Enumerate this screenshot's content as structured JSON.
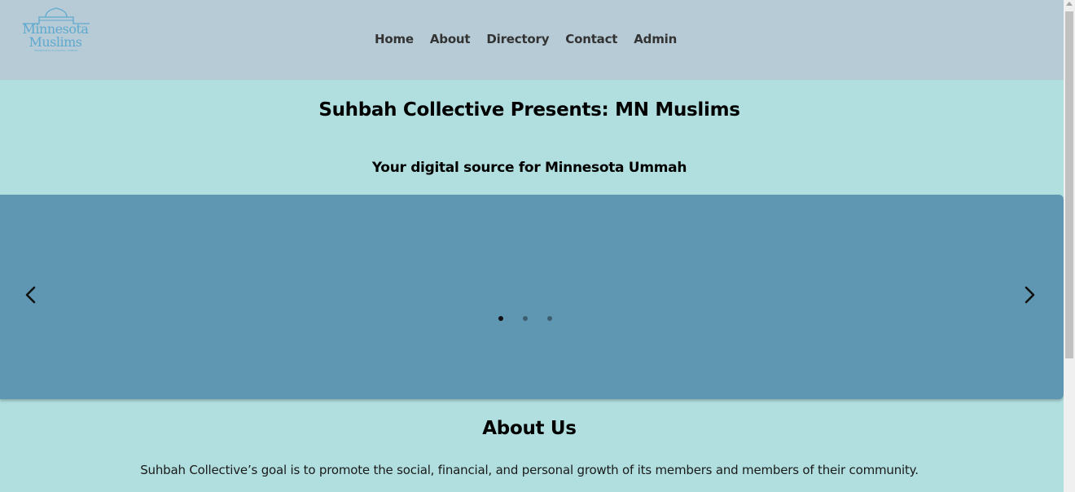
{
  "logo": {
    "line1": "Minnesota",
    "line2": "Muslims",
    "tagline": "MINNESOTA'S DIGITAL UMMAH",
    "color": "#5fa9cf"
  },
  "nav": {
    "items": [
      "Home",
      "About",
      "Directory",
      "Contact",
      "Admin"
    ]
  },
  "hero": {
    "title": "Suhbah Collective Presents: MN Muslims",
    "subtitle": "Your digital source for Minnesota Ummah"
  },
  "carousel": {
    "prev_icon": "chevron-left-icon",
    "next_icon": "chevron-right-icon",
    "slide_count": 3,
    "active_slide": 1,
    "background": "#5f97b3"
  },
  "about": {
    "title": "About Us",
    "text": "Suhbah Collective’s goal is to promote the social, financial, and personal growth of its members and members of their community."
  },
  "colors": {
    "header_bg": "#b6cbd6",
    "page_bg": "#b1dfdf",
    "nav_text": "#333333"
  }
}
